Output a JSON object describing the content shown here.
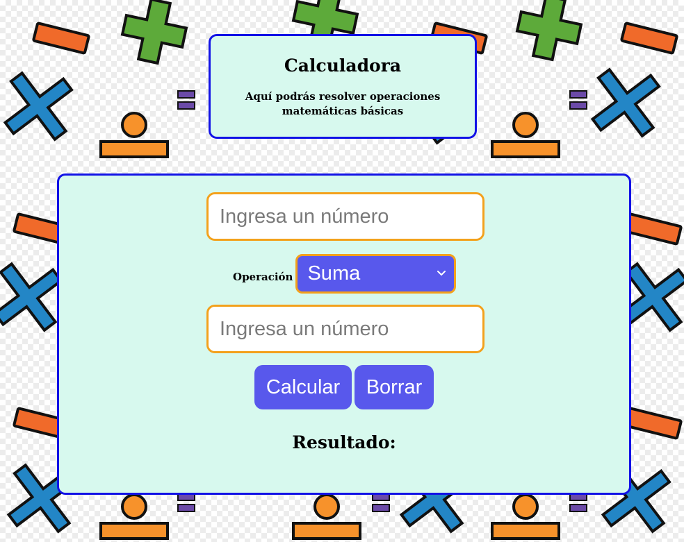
{
  "header": {
    "title": "Calculadora",
    "subtitle": "Aquí podrás resolver operaciones matemáticas básicas"
  },
  "form": {
    "first_number": {
      "value": "",
      "placeholder": "Ingresa un número"
    },
    "operation": {
      "label": "Operación",
      "selected": "Suma",
      "icon": "chevron-down-icon"
    },
    "second_number": {
      "value": "",
      "placeholder": "Ingresa un número"
    },
    "buttons": {
      "calculate": "Calcular",
      "clear": "Borrar"
    },
    "result_label": "Resultado:"
  },
  "colors": {
    "card_background": "#d7f9ee",
    "card_border": "#1212e6",
    "input_border": "#f3a11c",
    "button_background": "#5858ec",
    "button_text": "#ffffff"
  },
  "background_pattern": {
    "description_icons": [
      "minus-sign",
      "plus-sign",
      "times-sign",
      "division-sign"
    ]
  }
}
